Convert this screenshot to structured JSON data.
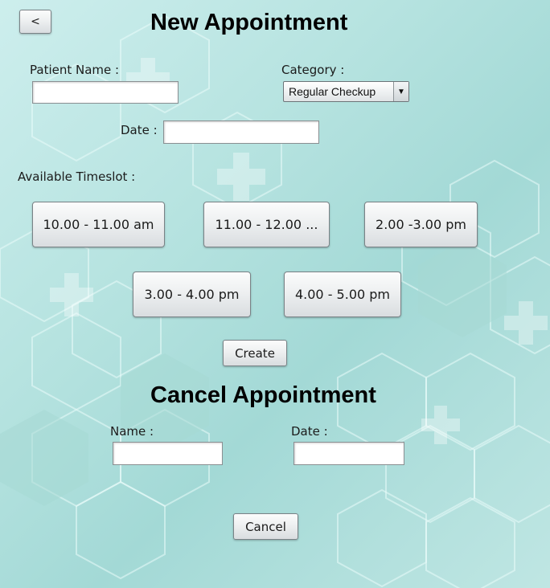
{
  "header": {
    "back_label": "<",
    "title": "New Appointment"
  },
  "new_appointment": {
    "patient_name_label": "Patient Name :",
    "patient_name_value": "",
    "category_label": "Category :",
    "category_selected": "Regular Checkup",
    "date_label": "Date :",
    "date_value": "",
    "timeslot_label": "Available Timeslot :",
    "timeslots": [
      "10.00 - 11.00 am",
      "11.00 - 12.00 ...",
      "2.00 -3.00 pm",
      "3.00 - 4.00 pm",
      "4.00 - 5.00 pm"
    ],
    "create_label": "Create"
  },
  "cancel_appointment": {
    "title": "Cancel Appointment",
    "name_label": "Name :",
    "name_value": "",
    "date_label": "Date :",
    "date_value": "",
    "cancel_label": "Cancel"
  },
  "icons": {
    "dropdown": "chevron-down-icon"
  },
  "colors": {
    "background": "#b6e3e0",
    "hex_stroke": "#8fd0cb"
  }
}
